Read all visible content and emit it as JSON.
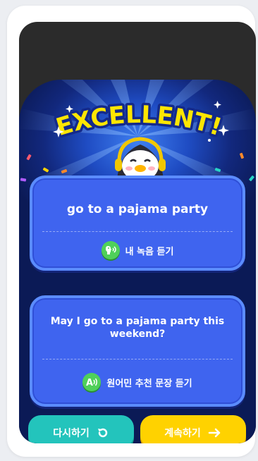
{
  "result": {
    "headline": "EXCELLENT!",
    "phrase_card": {
      "text": "go to a pajama party",
      "listen_label": "내 녹음 듣기",
      "listen_icon": "voice-icon"
    },
    "sentence_card": {
      "text": "May I go to a pajama party this weekend?",
      "listen_label": "원어민 추천 문장 듣기",
      "listen_icon": "a-speaker-icon"
    }
  },
  "actions": {
    "retry_label": "다시하기",
    "retry_icon": "retry-icon",
    "next_label": "계속하기",
    "next_icon": "arrow-right-icon"
  },
  "colors": {
    "stage_blue": "#1f4cc3",
    "card_blue": "#3f64ef",
    "retry_teal": "#23c4bc",
    "next_yellow": "#ffd200",
    "headline_yellow": "#ffe600",
    "badge_green": "#4fd05a"
  }
}
